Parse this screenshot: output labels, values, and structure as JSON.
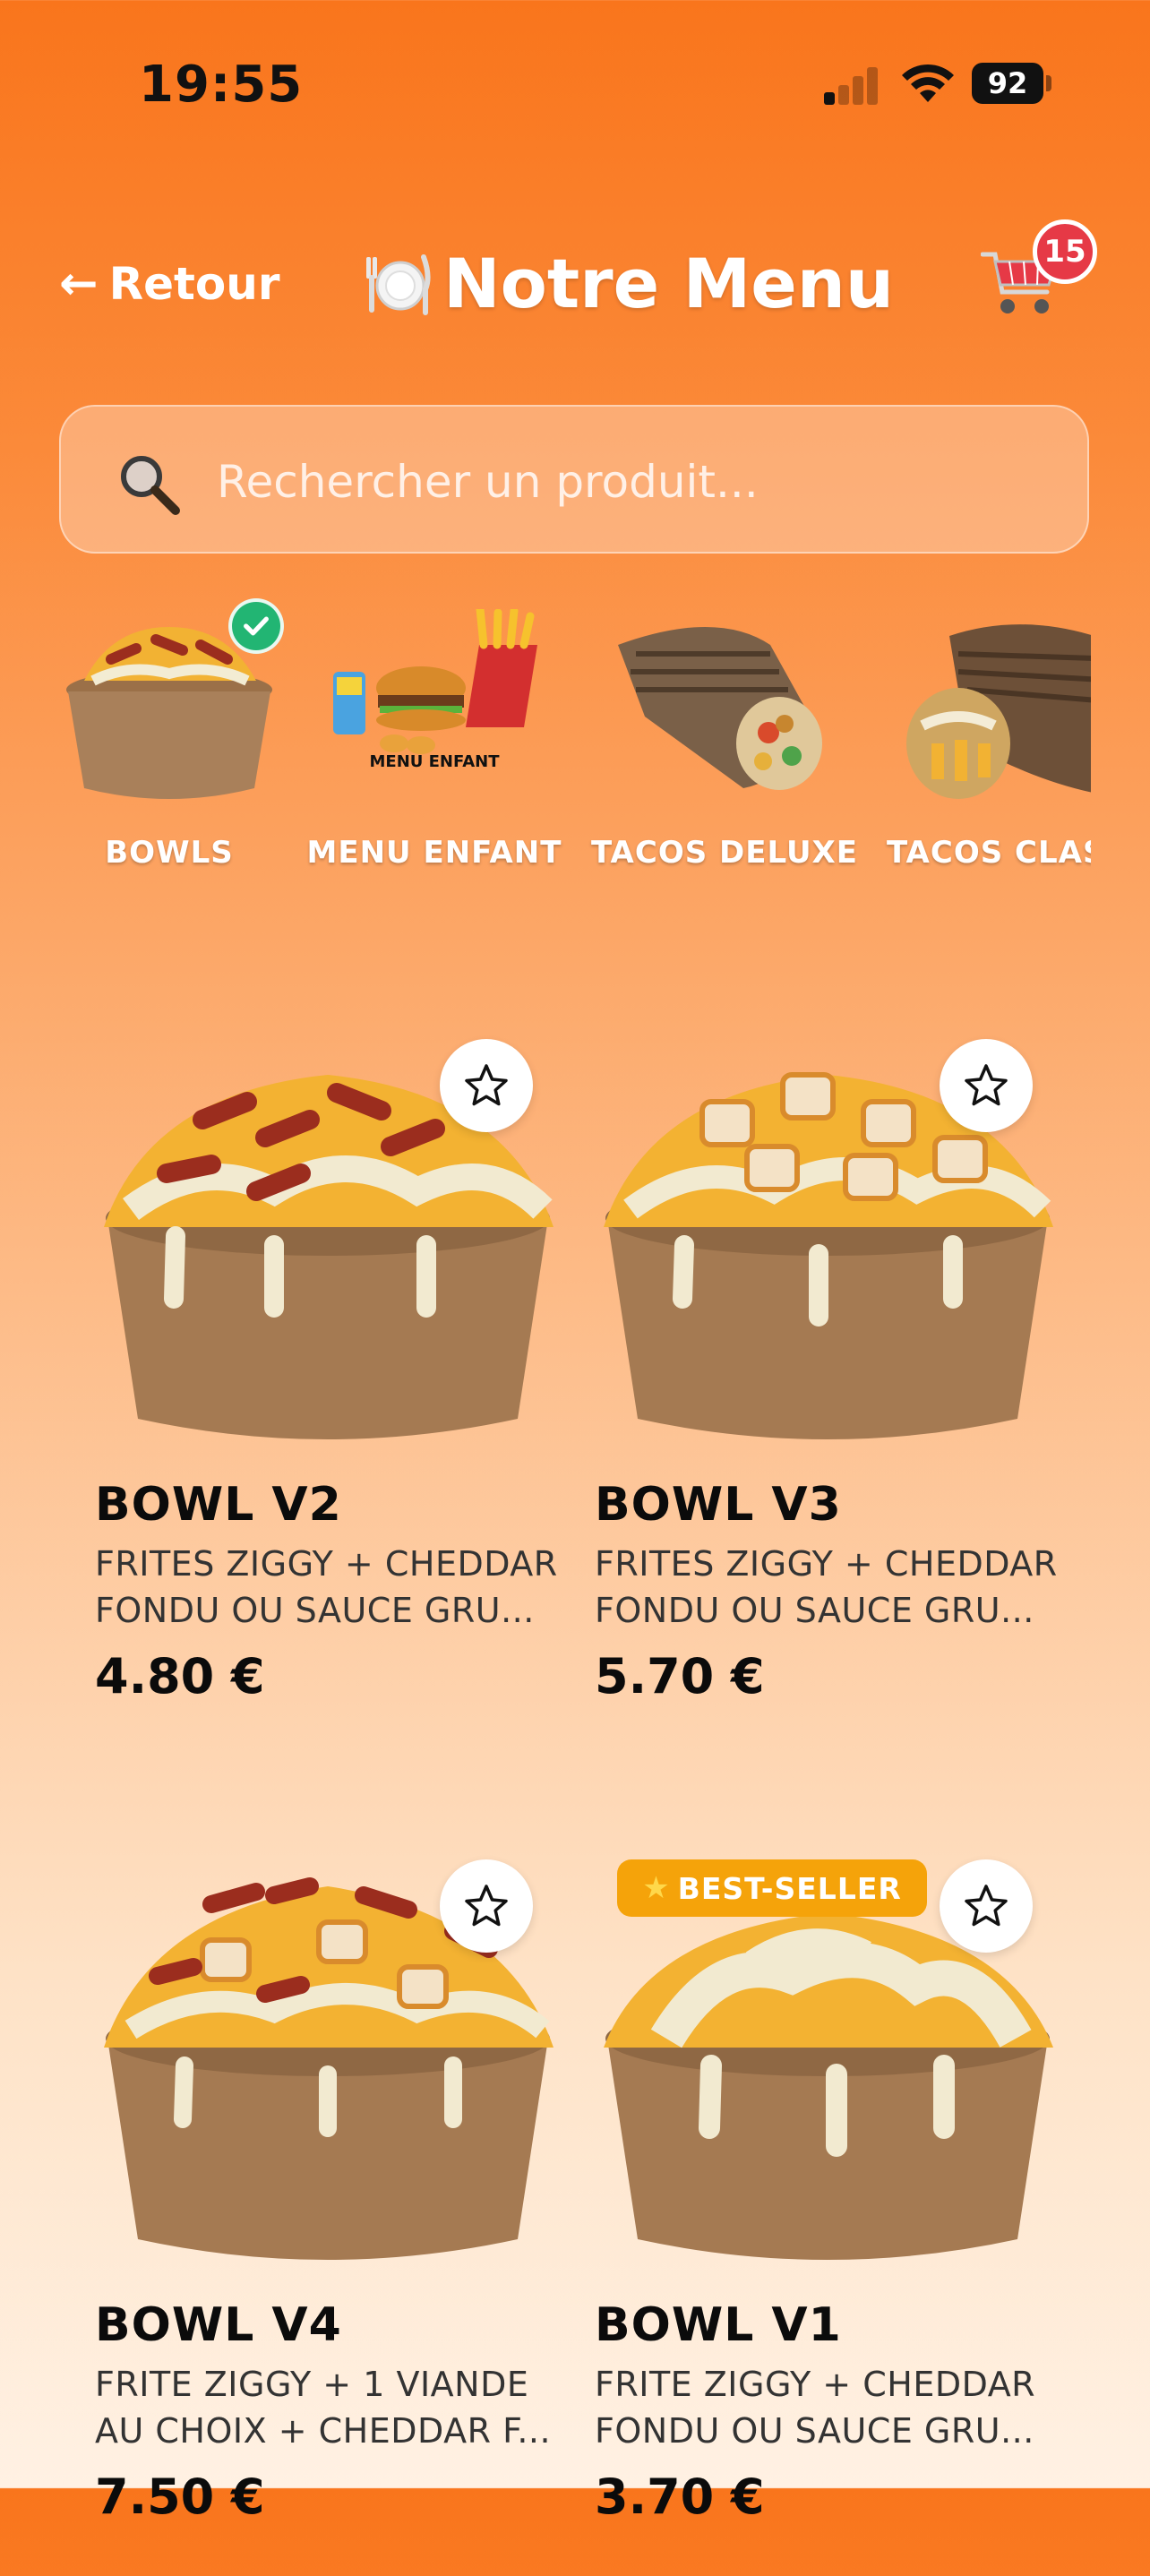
{
  "status": {
    "time": "19:55",
    "battery": "92"
  },
  "header": {
    "back_label": "Retour",
    "title": "Notre Menu",
    "cart_count": "15"
  },
  "search": {
    "placeholder": "Rechercher un produit..."
  },
  "categories": [
    {
      "label": "BOWLS",
      "selected": true
    },
    {
      "label": "MENU ENFANT",
      "image_text": "MENU ENFANT"
    },
    {
      "label": "TACOS DELUXE"
    },
    {
      "label": "TACOS CLASSIQUE"
    }
  ],
  "products": [
    {
      "name": "BOWL V2",
      "desc": "FRITES ZIGGY + CHEDDAR FONDU OU SAUCE GRU...",
      "price": "4.80 €"
    },
    {
      "name": "BOWL V3",
      "desc": "FRITES ZIGGY + CHEDDAR FONDU OU SAUCE GRU...",
      "price": "5.70 €"
    },
    {
      "name": "BOWL V4",
      "desc": "FRITE ZIGGY + 1 VIANDE AU CHOIX + CHEDDAR F...",
      "price": "7.50 €"
    },
    {
      "name": "BOWL V1",
      "desc": "FRITE ZIGGY + CHEDDAR FONDU OU SAUCE GRU...",
      "price": "3.70 €",
      "badge": "BEST-SELLER"
    }
  ],
  "colors": {
    "accent": "#f9751c",
    "badge_red": "#e63946",
    "check_green": "#22b573",
    "bestseller": "#f5a30a"
  },
  "icons": [
    "back-arrow-icon",
    "plate-icon",
    "cart-icon",
    "search-icon",
    "check-icon",
    "star-icon"
  ]
}
